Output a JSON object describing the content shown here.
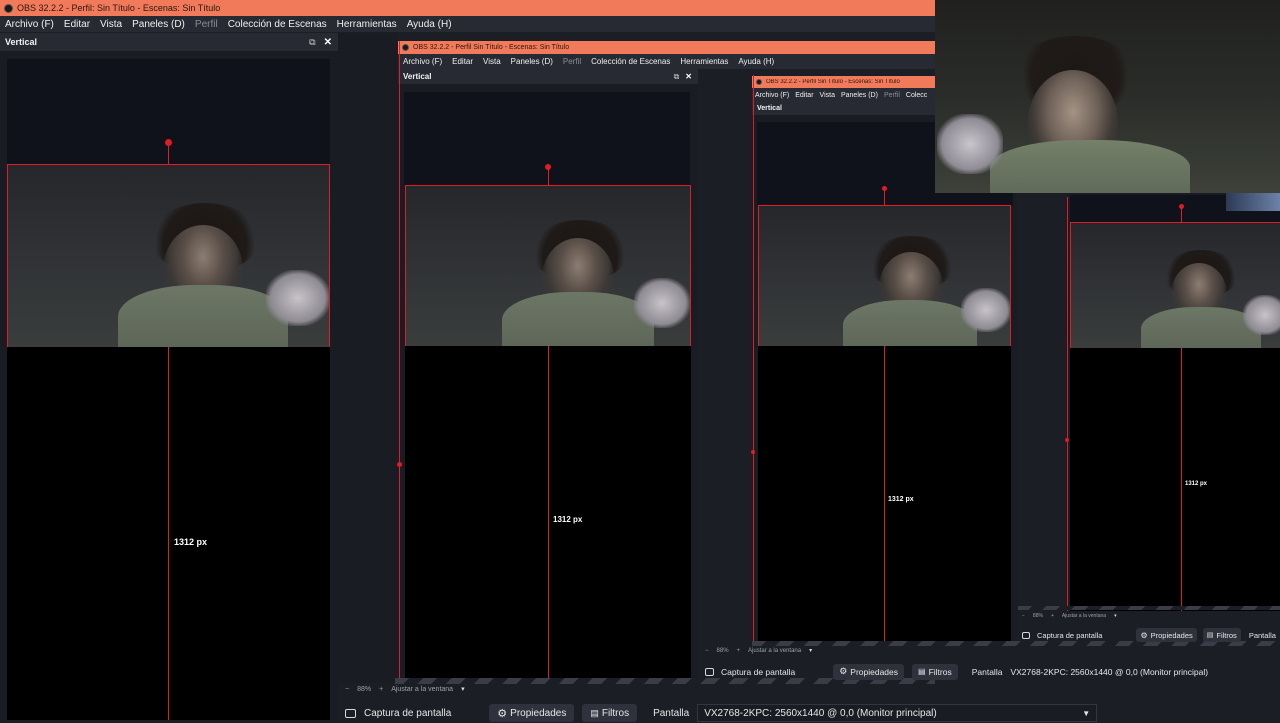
{
  "app": {
    "title": "OBS 32.2.2 - Perfil: Sin Título - Escenas: Sin Título",
    "title_nested": "OBS 32.2.2 - Perfil Sin Título - Escenas: Sin Título"
  },
  "menu": {
    "archivo": "Archivo (F)",
    "editar": "Editar",
    "vista": "Vista",
    "paneles": "Paneles (D)",
    "perfil": "Perfil",
    "coleccion": "Colección de Escenas",
    "herramientas": "Herramientas",
    "ayuda": "Ayuda (H)",
    "coleccion_short": "Colecc"
  },
  "dock": {
    "title": "Vertical",
    "undock_glyph": "⧉",
    "close_glyph": "✕"
  },
  "canvas": {
    "measure_label": "1312 px"
  },
  "zoom": {
    "minus": "−",
    "level": "88%",
    "plus": "+",
    "fit_label": "Ajustar a la ventana",
    "dropdown_glyph": "▾"
  },
  "source_bar": {
    "source_name": "Captura de pantalla",
    "properties_label": "Propiedades",
    "filters_label": "Filtros",
    "screen_label": "Pantalla",
    "screen_value": "VX2768-2KPC: 2560x1440 @ 0,0 (Monitor principal)"
  },
  "colors": {
    "titlebar": "#f07a5a",
    "selection": "#e01c24",
    "panel_bg": "#22242c"
  }
}
